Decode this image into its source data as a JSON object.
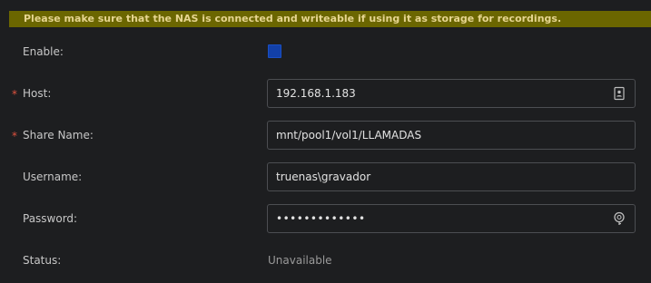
{
  "banner": {
    "text": "Please make sure that the NAS is connected and writeable if using it as storage for recordings."
  },
  "form": {
    "enable": {
      "label": "Enable:",
      "checked": true
    },
    "host": {
      "label": "Host:",
      "required_mark": "*",
      "value": "192.168.1.183",
      "icon": "contact-card-icon"
    },
    "share_name": {
      "label": "Share Name:",
      "required_mark": "*",
      "value": "mnt/pool1/vol1/LLAMADAS"
    },
    "username": {
      "label": "Username:",
      "value": "truenas\\gravador"
    },
    "password": {
      "label": "Password:",
      "value": "•••••••••••••",
      "icon": "key-icon"
    },
    "status": {
      "label": "Status:",
      "value": "Unavailable"
    }
  },
  "colors": {
    "banner_bg": "#6b6600",
    "banner_text": "#e6d590",
    "checkbox": "#1240a8",
    "required": "#e0533f"
  }
}
